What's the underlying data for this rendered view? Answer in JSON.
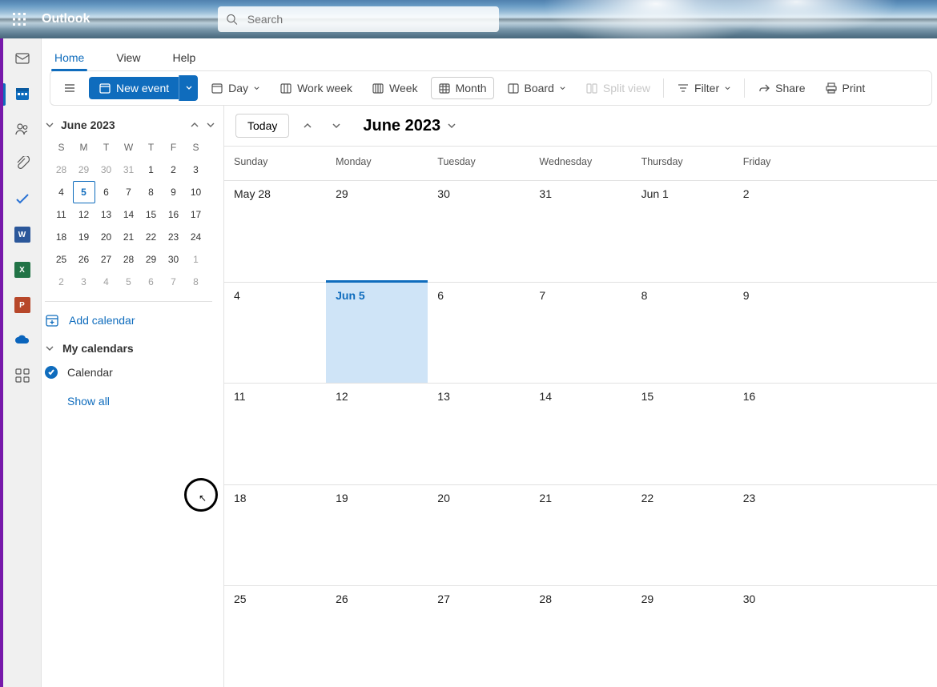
{
  "app_name": "Outlook",
  "search_placeholder": "Search",
  "tabs": {
    "home": "Home",
    "view": "View",
    "help": "Help"
  },
  "toolbar": {
    "new_event": "New event",
    "day": "Day",
    "work_week": "Work week",
    "week": "Week",
    "month": "Month",
    "board": "Board",
    "split_view": "Split view",
    "filter": "Filter",
    "share": "Share",
    "print": "Print"
  },
  "mini": {
    "title": "June 2023",
    "dow": [
      "S",
      "M",
      "T",
      "W",
      "T",
      "F",
      "S"
    ],
    "weeks": [
      [
        {
          "n": "28",
          "f": 1
        },
        {
          "n": "29",
          "f": 1
        },
        {
          "n": "30",
          "f": 1
        },
        {
          "n": "31",
          "f": 1
        },
        {
          "n": "1"
        },
        {
          "n": "2"
        },
        {
          "n": "3"
        }
      ],
      [
        {
          "n": "4"
        },
        {
          "n": "5",
          "today": 1
        },
        {
          "n": "6"
        },
        {
          "n": "7"
        },
        {
          "n": "8"
        },
        {
          "n": "9"
        },
        {
          "n": "10"
        }
      ],
      [
        {
          "n": "11"
        },
        {
          "n": "12"
        },
        {
          "n": "13"
        },
        {
          "n": "14"
        },
        {
          "n": "15"
        },
        {
          "n": "16"
        },
        {
          "n": "17"
        }
      ],
      [
        {
          "n": "18"
        },
        {
          "n": "19"
        },
        {
          "n": "20"
        },
        {
          "n": "21"
        },
        {
          "n": "22"
        },
        {
          "n": "23"
        },
        {
          "n": "24"
        }
      ],
      [
        {
          "n": "25"
        },
        {
          "n": "26"
        },
        {
          "n": "27"
        },
        {
          "n": "28"
        },
        {
          "n": "29"
        },
        {
          "n": "30"
        },
        {
          "n": "1",
          "f": 1
        }
      ],
      [
        {
          "n": "2",
          "f": 1
        },
        {
          "n": "3",
          "f": 1
        },
        {
          "n": "4",
          "f": 1
        },
        {
          "n": "5",
          "f": 1
        },
        {
          "n": "6",
          "f": 1
        },
        {
          "n": "7",
          "f": 1
        },
        {
          "n": "8",
          "f": 1
        }
      ]
    ]
  },
  "add_calendar": "Add calendar",
  "my_calendars": "My calendars",
  "calendar_item": "Calendar",
  "show_all": "Show all",
  "view": {
    "today": "Today",
    "month_title": "June 2023",
    "dow": [
      "Sunday",
      "Monday",
      "Tuesday",
      "Wednesday",
      "Thursday",
      "Friday"
    ],
    "weeks": [
      [
        {
          "t": "May 28"
        },
        {
          "t": "29"
        },
        {
          "t": "30"
        },
        {
          "t": "31"
        },
        {
          "t": "Jun 1"
        },
        {
          "t": "2"
        }
      ],
      [
        {
          "t": "4"
        },
        {
          "t": "Jun 5",
          "today": 1
        },
        {
          "t": "6"
        },
        {
          "t": "7"
        },
        {
          "t": "8"
        },
        {
          "t": "9"
        }
      ],
      [
        {
          "t": "11"
        },
        {
          "t": "12"
        },
        {
          "t": "13"
        },
        {
          "t": "14"
        },
        {
          "t": "15"
        },
        {
          "t": "16"
        }
      ],
      [
        {
          "t": "18"
        },
        {
          "t": "19"
        },
        {
          "t": "20"
        },
        {
          "t": "21"
        },
        {
          "t": "22"
        },
        {
          "t": "23"
        }
      ],
      [
        {
          "t": "25"
        },
        {
          "t": "26"
        },
        {
          "t": "27"
        },
        {
          "t": "28"
        },
        {
          "t": "29"
        },
        {
          "t": "30"
        }
      ]
    ]
  },
  "rail_docs": [
    {
      "bg": "#2B579A",
      "t": "W"
    },
    {
      "bg": "#217346",
      "t": "X"
    },
    {
      "bg": "#B7472A",
      "t": "P"
    }
  ]
}
